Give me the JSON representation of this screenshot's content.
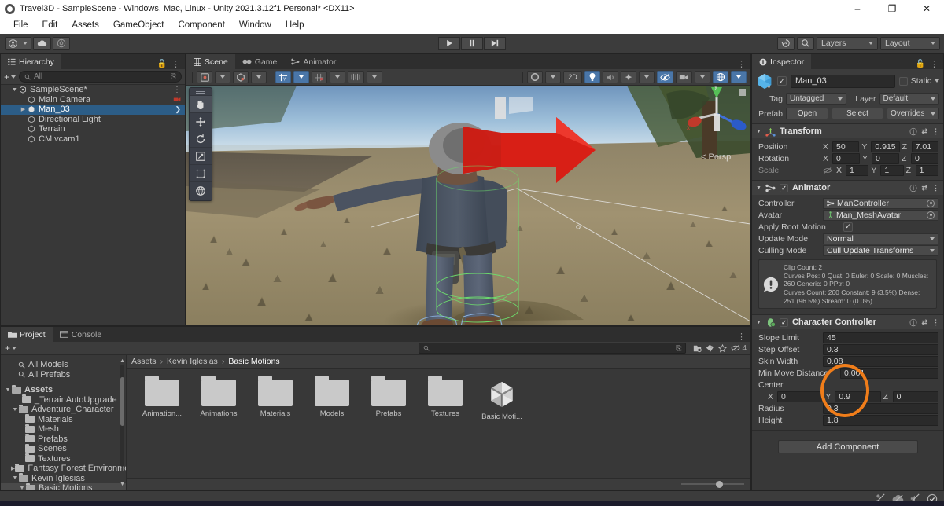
{
  "window": {
    "title": "Travel3D - SampleScene - Windows, Mac, Linux - Unity 2021.3.12f1 Personal* <DX11>",
    "minimize": "–",
    "maximize": "❐",
    "close": "✕"
  },
  "menubar": {
    "items": [
      "File",
      "Edit",
      "Assets",
      "GameObject",
      "Component",
      "Window",
      "Help"
    ]
  },
  "toolbar": {
    "account_icon": "account-icon",
    "cloud_icon": "cloud-icon",
    "collab_icon": "collab-icon",
    "play": "▶",
    "pause": "❙❙",
    "step": "▶❙",
    "undo_history_icon": "undo-history-icon",
    "search_icon": "search-icon",
    "layers_label": "Layers",
    "layout_label": "Layout"
  },
  "hierarchy": {
    "tab": "Hierarchy",
    "search_placeholder": "All",
    "plus_label": "+",
    "rows": [
      {
        "label": "SampleScene*",
        "depth": 0,
        "expanded": true,
        "selected": false,
        "icon": "scene-icon"
      },
      {
        "label": "Main Camera",
        "depth": 1,
        "expanded": null,
        "selected": false,
        "icon": "gameobject-icon"
      },
      {
        "label": "Man_03",
        "depth": 1,
        "expanded": false,
        "selected": true,
        "icon": "prefab-icon"
      },
      {
        "label": "Directional Light",
        "depth": 1,
        "expanded": null,
        "selected": false,
        "icon": "gameobject-icon"
      },
      {
        "label": "Terrain",
        "depth": 1,
        "expanded": null,
        "selected": false,
        "icon": "gameobject-icon"
      },
      {
        "label": "CM vcam1",
        "depth": 1,
        "expanded": null,
        "selected": false,
        "icon": "gameobject-icon"
      }
    ]
  },
  "scene": {
    "tabs": [
      {
        "label": "Scene",
        "icon": "scene-grid-icon",
        "active": true
      },
      {
        "label": "Game",
        "icon": "game-icon",
        "active": false
      },
      {
        "label": "Animator",
        "icon": "animator-icon",
        "active": false
      }
    ],
    "toolbar": {
      "shading_mode": "shaded-mode-icon",
      "draw_mode": "draw-mode-icon",
      "twod_label": "2D",
      "lighting_icon": "lighting-icon",
      "audio_icon": "audio-icon",
      "fx_icon": "effects-icon",
      "visibility_icon": "scene-visibility-icon",
      "camera_icon": "scene-camera-icon",
      "gizmos_icon": "gizmos-icon"
    },
    "tools": [
      "hand-tool",
      "move-tool",
      "rotate-tool",
      "scale-tool",
      "rect-tool",
      "transform-tool"
    ],
    "gizmo": {
      "persp_label": "Persp",
      "x_label": "x",
      "y_label": "y"
    }
  },
  "project": {
    "tabs": [
      {
        "label": "Project",
        "icon": "project-icon",
        "active": true
      },
      {
        "label": "Console",
        "icon": "console-icon",
        "active": false
      }
    ],
    "search_placeholder": "",
    "filter_count": "4",
    "tree": [
      {
        "label": "All Models",
        "depth": 1,
        "type": "search",
        "expanded": null,
        "selected": false
      },
      {
        "label": "All Prefabs",
        "depth": 1,
        "type": "search",
        "expanded": null,
        "selected": false
      },
      {
        "label": "Assets",
        "depth": 0,
        "type": "folder",
        "expanded": true,
        "selected": false
      },
      {
        "label": "_TerrainAutoUpgrade",
        "depth": 1,
        "type": "folder",
        "expanded": null,
        "selected": false
      },
      {
        "label": "Adventure_Character",
        "depth": 1,
        "type": "folder",
        "expanded": true,
        "selected": false
      },
      {
        "label": "Materials",
        "depth": 2,
        "type": "folder",
        "expanded": null,
        "selected": false
      },
      {
        "label": "Mesh",
        "depth": 2,
        "type": "folder",
        "expanded": null,
        "selected": false
      },
      {
        "label": "Prefabs",
        "depth": 2,
        "type": "folder",
        "expanded": null,
        "selected": false
      },
      {
        "label": "Scenes",
        "depth": 2,
        "type": "folder",
        "expanded": null,
        "selected": false
      },
      {
        "label": "Textures",
        "depth": 2,
        "type": "folder",
        "expanded": null,
        "selected": false
      },
      {
        "label": "Fantasy Forest Environme",
        "depth": 1,
        "type": "folder",
        "expanded": false,
        "selected": false
      },
      {
        "label": "Kevin Iglesias",
        "depth": 1,
        "type": "folder",
        "expanded": true,
        "selected": false
      },
      {
        "label": "Basic Motions",
        "depth": 2,
        "type": "folder",
        "expanded": true,
        "selected": true
      }
    ],
    "breadcrumb": [
      "Assets",
      "Kevin Iglesias",
      "Basic Motions"
    ],
    "assets": [
      {
        "name": "Animation...",
        "type": "folder"
      },
      {
        "name": "Animations",
        "type": "folder"
      },
      {
        "name": "Materials",
        "type": "folder"
      },
      {
        "name": "Models",
        "type": "folder"
      },
      {
        "name": "Prefabs",
        "type": "folder"
      },
      {
        "name": "Textures",
        "type": "folder"
      },
      {
        "name": "Basic Moti...",
        "type": "unity-package"
      }
    ]
  },
  "inspector": {
    "tab": "Inspector",
    "object": {
      "name": "Man_03",
      "enabled": true,
      "static_label": "Static",
      "tag_label": "Tag",
      "tag_value": "Untagged",
      "layer_label": "Layer",
      "layer_value": "Default",
      "prefab_label": "Prefab",
      "open_label": "Open",
      "select_label": "Select",
      "overrides_label": "Overrides"
    },
    "components": [
      {
        "name": "Transform",
        "icon": "transform-icon",
        "enabled": null,
        "rows": [
          {
            "label": "Position",
            "type": "vector3",
            "x": "50",
            "y": "0.915",
            "z": "7.01"
          },
          {
            "label": "Rotation",
            "type": "vector3",
            "x": "0",
            "y": "0",
            "z": "0"
          },
          {
            "label": "Scale",
            "type": "vector3",
            "x": "1",
            "y": "1",
            "z": "1",
            "dim": true,
            "link_icon": "constrain-proportions-off-icon"
          }
        ]
      },
      {
        "name": "Animator",
        "icon": "animator-icon",
        "enabled": true,
        "rows": [
          {
            "label": "Controller",
            "type": "object",
            "value": "ManController",
            "obj_icon": "animator-controller-icon"
          },
          {
            "label": "Avatar",
            "type": "object",
            "value": "Man_MeshAvatar",
            "obj_icon": "avatar-icon"
          },
          {
            "label": "Apply Root Motion",
            "type": "checkbox",
            "value": true
          },
          {
            "label": "Update Mode",
            "type": "dropdown",
            "value": "Normal"
          },
          {
            "label": "Culling Mode",
            "type": "dropdown",
            "value": "Cull Update Transforms"
          }
        ],
        "info": "Clip Count: 2\nCurves Pos: 0 Quat: 0 Euler: 0 Scale: 0 Muscles: 260 Generic: 0 PPtr: 0\nCurves Count: 260 Constant: 9 (3.5%) Dense: 251 (96.5%) Stream: 0 (0.0%)"
      },
      {
        "name": "Character Controller",
        "icon": "character-controller-icon",
        "enabled": true,
        "rows": [
          {
            "label": "Slope Limit",
            "type": "text",
            "value": "45"
          },
          {
            "label": "Step Offset",
            "type": "text",
            "value": "0.3"
          },
          {
            "label": "Skin Width",
            "type": "text",
            "value": "0.08"
          },
          {
            "label": "Min Move Distance",
            "type": "text",
            "value": "0.001"
          },
          {
            "label": "Center",
            "type": "header"
          },
          {
            "label": "",
            "type": "vector3",
            "x": "0",
            "y": "0.9",
            "z": "0"
          },
          {
            "label": "Radius",
            "type": "text",
            "value": "0.3"
          },
          {
            "label": "Height",
            "type": "text",
            "value": "1.8"
          }
        ]
      }
    ],
    "add_component_label": "Add Component"
  },
  "annotation": {
    "color": "#f07d1a",
    "shape": "ellipse"
  },
  "statusbar": {
    "icons": [
      "collab-no-icon",
      "cloud-build-icon",
      "no-sound-icon",
      "check-icon"
    ]
  },
  "colors": {
    "accent_blue": "#4a76a8",
    "selection_blue": "#2c5d87",
    "panel_bg": "#383838",
    "annotation_orange": "#f07d1a"
  }
}
